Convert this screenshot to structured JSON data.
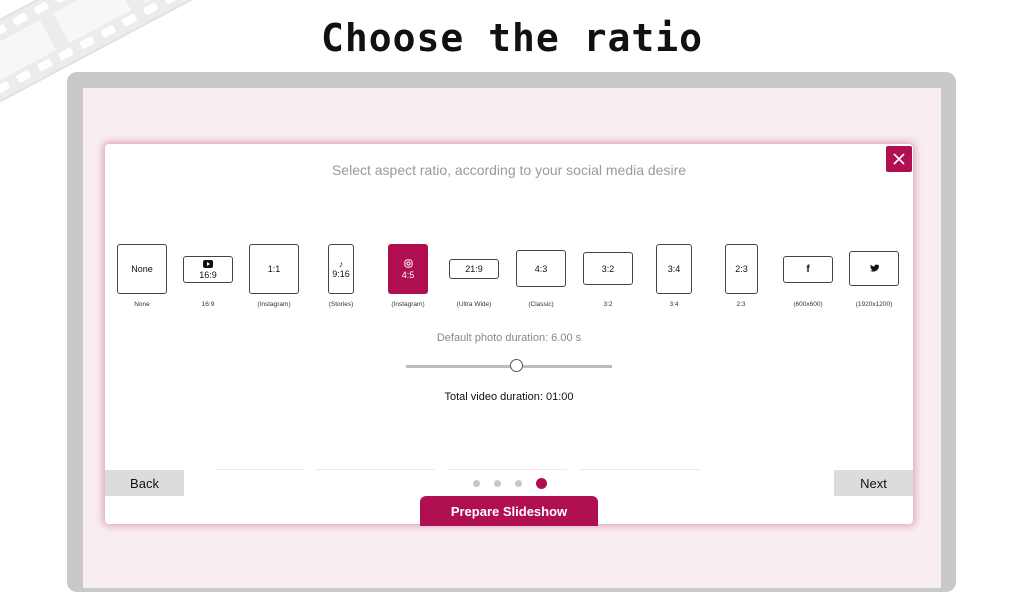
{
  "headline": "Choose the ratio",
  "dialog": {
    "subtitle": "Select aspect ratio, according to your social media desire",
    "close_icon": "close-icon",
    "ratios": [
      {
        "id": "none",
        "label": "None",
        "caption": "None",
        "icon": ""
      },
      {
        "id": "16-9",
        "label": "16:9",
        "caption": "16:9",
        "icon": "youtube-icon"
      },
      {
        "id": "1-1",
        "label": "1:1",
        "caption": "(Instagram)",
        "icon": ""
      },
      {
        "id": "9-16",
        "label": "9:16",
        "caption": "(Stories)",
        "icon": "tiktok-icon"
      },
      {
        "id": "4-5",
        "label": "4:5",
        "caption": "(Instagram)",
        "icon": "instagram-icon",
        "selected": true
      },
      {
        "id": "21-9",
        "label": "21:9",
        "caption": "(Ultra Wide)",
        "icon": ""
      },
      {
        "id": "4-3",
        "label": "4:3",
        "caption": "(Classic)",
        "icon": ""
      },
      {
        "id": "3-2",
        "label": "3:2",
        "caption": "3:2",
        "icon": ""
      },
      {
        "id": "3-4",
        "label": "3:4",
        "caption": "3:4",
        "icon": ""
      },
      {
        "id": "2-3",
        "label": "2:3",
        "caption": "2:3",
        "icon": ""
      },
      {
        "id": "facebook",
        "label": "",
        "caption": "(600x600)",
        "icon": "facebook-icon"
      },
      {
        "id": "twitter",
        "label": "",
        "caption": "(1920x1200)",
        "icon": "twitter-icon"
      }
    ],
    "duration_label": "Default photo duration: 6.00 s",
    "slider_value": 0.5,
    "total_label": "Total video duration: 01:00",
    "back_label": "Back",
    "next_label": "Next",
    "pager": {
      "pages": 4,
      "current": 4
    },
    "prepare_label": "Prepare Slideshow"
  },
  "colors": {
    "accent": "#b0104f",
    "frame": "#c9c9c9",
    "backdrop": "#f8eef1"
  }
}
